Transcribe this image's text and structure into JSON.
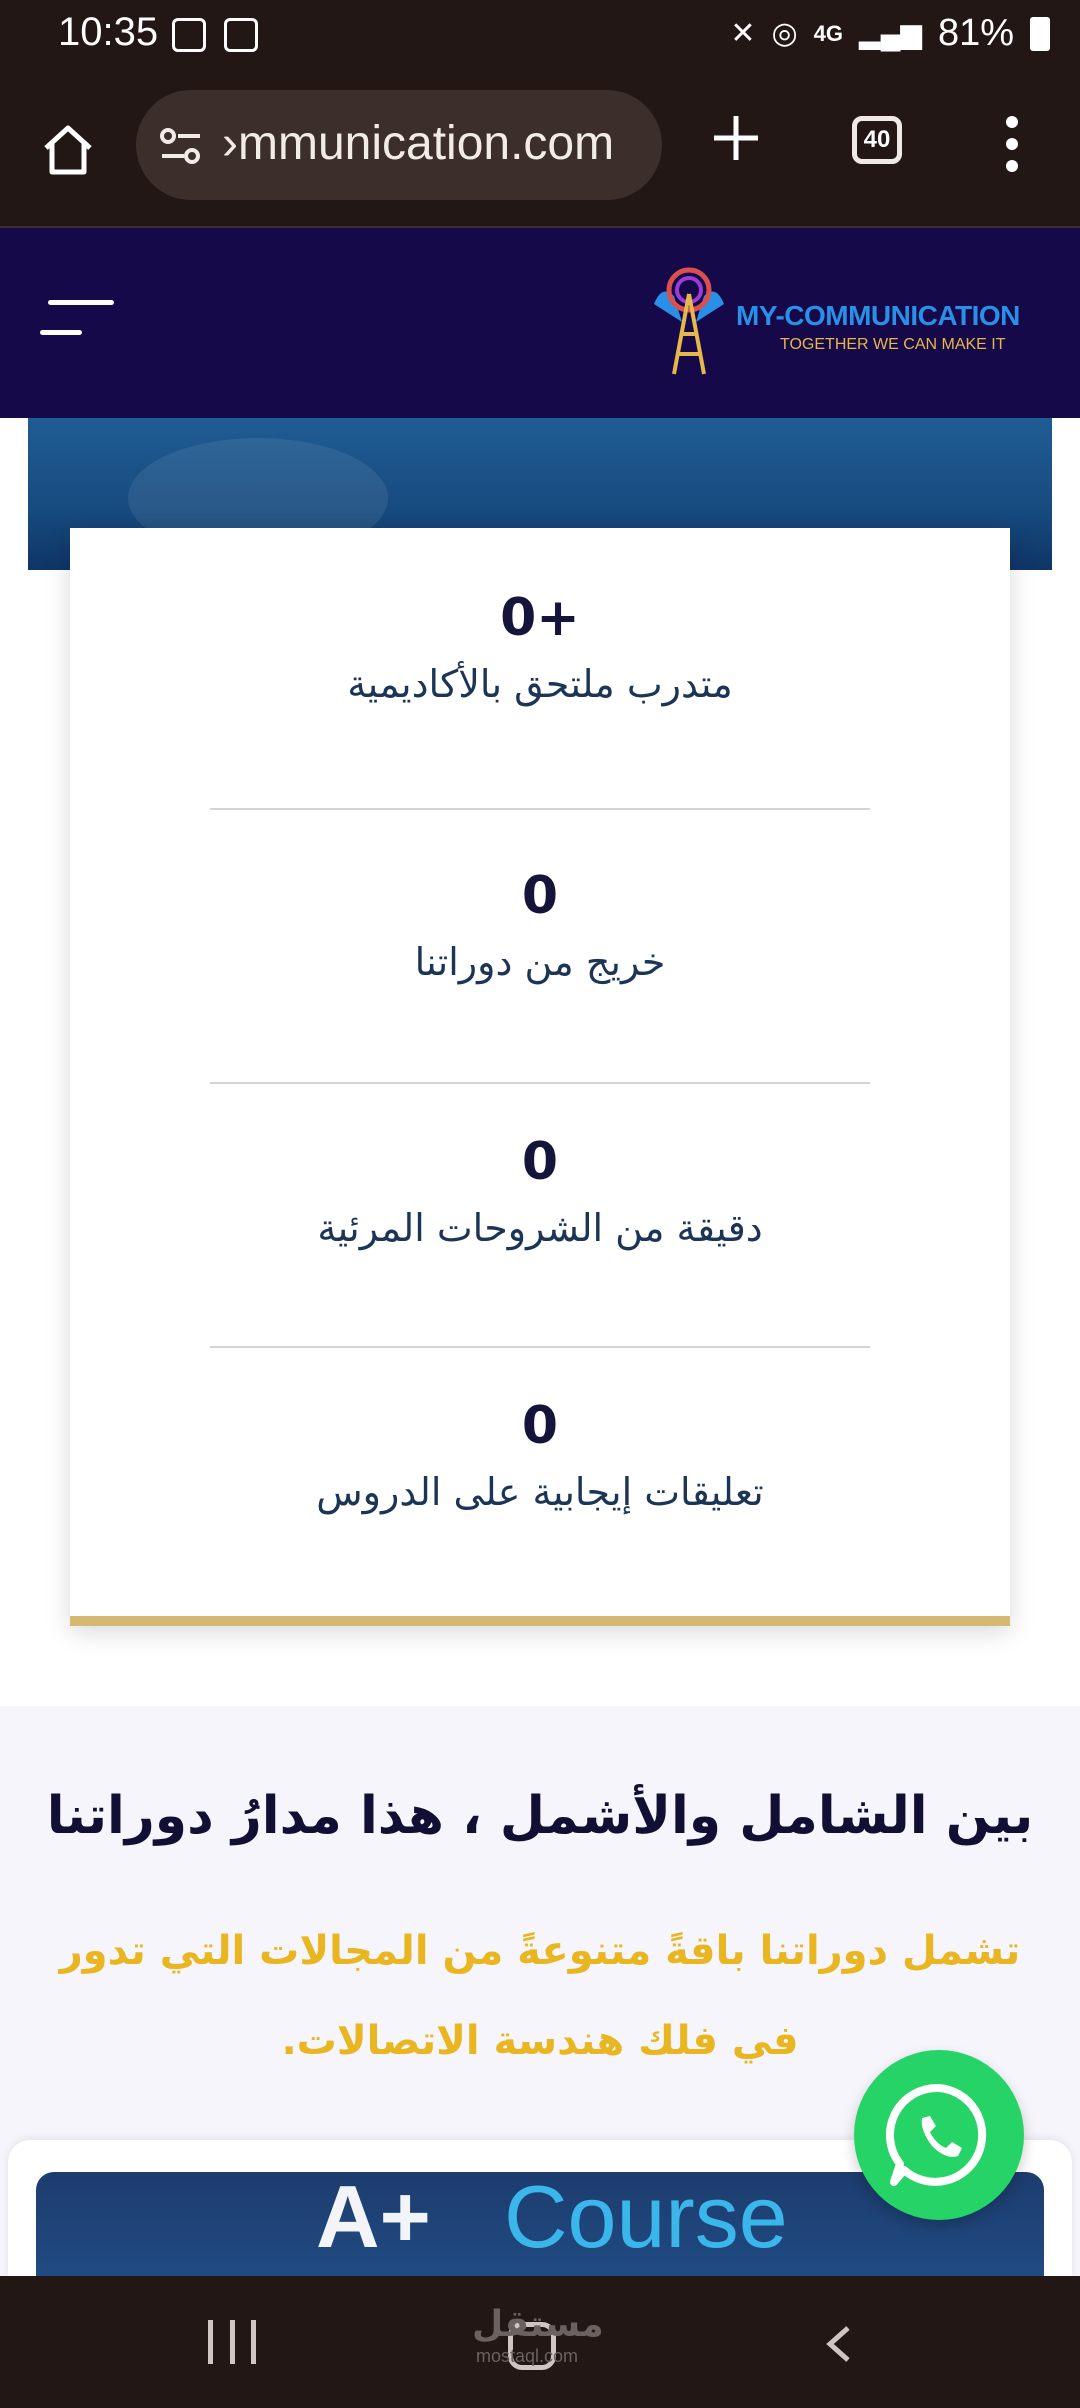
{
  "status_bar": {
    "time": "10:35",
    "network": "4G",
    "battery": "81%"
  },
  "browser": {
    "url": "›mmunication.com",
    "tab_count": "40"
  },
  "header": {
    "brand_name": "MY-COMMUNICATION",
    "tagline": "TOGETHER WE CAN MAKE IT"
  },
  "stats": [
    {
      "number": "0+",
      "label": "متدرب ملتحق بالأكاديمية"
    },
    {
      "number": "0",
      "label": "خريج من دوراتنا"
    },
    {
      "number": "0",
      "label": "دقيقة من الشروحات المرئية"
    },
    {
      "number": "0",
      "label": "تعليقات إيجابية على الدروس"
    }
  ],
  "section": {
    "title": "بين الشامل والأشمل ، هذا مدارُ دوراتنا",
    "subtitle": "تشمل دوراتنا باقةً متنوعةً من المجالات التي تدور في فلك هندسة الاتصالات."
  },
  "course_banner": {
    "aplus": "A+",
    "course": "Course"
  },
  "navbar": {
    "watermark": "مستقل",
    "watermark_sub": "mostaql.com"
  },
  "colors": {
    "header_bg": "#15094a",
    "accent_gold": "#d5b872",
    "subtitle_yellow": "#e9b621",
    "whatsapp_green": "#25d366"
  }
}
